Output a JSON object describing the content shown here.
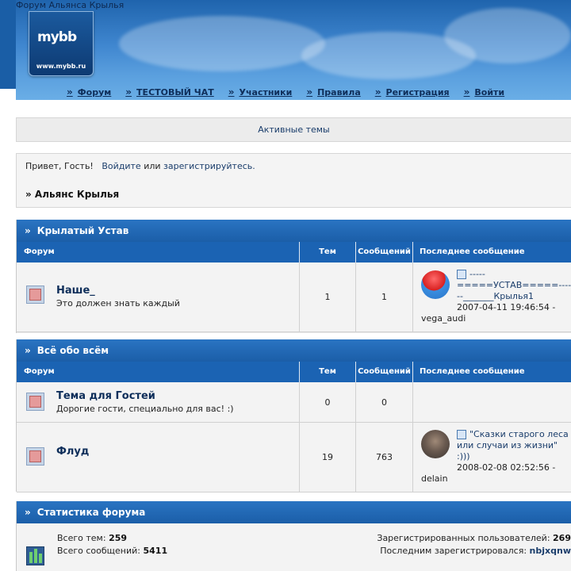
{
  "header": {
    "site_title": "Форум Альянса Крылья",
    "logo_mark": "mybb",
    "logo_sub": "www.mybb.ru"
  },
  "nav": [
    {
      "label": "Форум"
    },
    {
      "label": "ТЕСТОВЫЙ ЧАТ"
    },
    {
      "label": "Участники"
    },
    {
      "label": "Правила"
    },
    {
      "label": "Регистрация"
    },
    {
      "label": "Войти"
    }
  ],
  "active_topics": "Активные темы",
  "welcome": {
    "greeting": "Привет, Гость!",
    "login_link": "Войдите",
    "or_text": "или",
    "register_link": "зарегистрируйтесь.",
    "breadcrumb": "» Альянс Крылья"
  },
  "columns": {
    "forum": "Форум",
    "topics": "Тем",
    "messages": "Сообщений",
    "last_post": "Последнее сообщение"
  },
  "categories": [
    {
      "title": "Крылатый Устав",
      "forums": [
        {
          "name": "Наше_",
          "description": "Это должен знать каждый",
          "topics": "1",
          "messages": "1",
          "last_post": {
            "title": "-----=====УСТАВ=====------_______Крылья1",
            "date": "2007-04-11 19:46:54 -",
            "user": "vega_audi",
            "avatar": "red-blue-avatar"
          }
        }
      ]
    },
    {
      "title": "Всё обо всём",
      "forums": [
        {
          "name": "Тема для Гостей",
          "description": "Дорогие гости, специально для вас! :)",
          "topics": "0",
          "messages": "0"
        },
        {
          "name": "Флуд",
          "description": "",
          "topics": "19",
          "messages": "763",
          "last_post": {
            "title": "\"Сказки старого леса или случаи из жизни\" :)))",
            "date": "2008-02-08 02:52:56 -",
            "user": "delain",
            "avatar": "gray-avatar"
          }
        }
      ]
    }
  ],
  "stats": {
    "title": "Статистика форума",
    "total_topics_label": "Всего тем:",
    "total_topics": "259",
    "total_messages_label": "Всего сообщений:",
    "total_messages": "5411",
    "registered_label": "Зарегистрированных пользователей:",
    "registered": "269",
    "last_registered_label": "Последним зарегистрировался:",
    "last_registered": "nbjxqnw"
  },
  "colors": {
    "header_blue": "#2a74c2",
    "column_head": "#1b63b3",
    "link": "#1a3d6b"
  }
}
